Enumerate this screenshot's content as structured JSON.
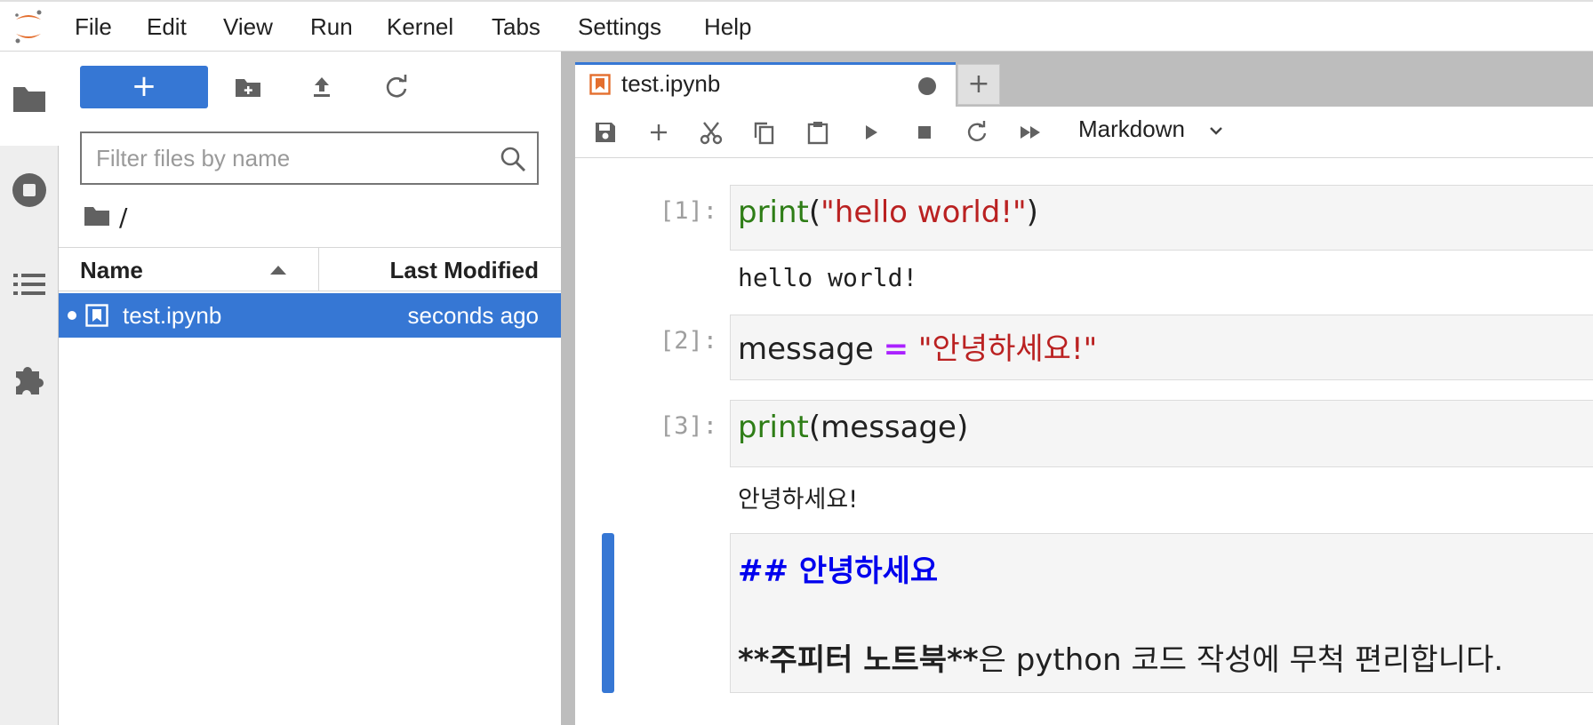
{
  "menubar": {
    "items": [
      "File",
      "Edit",
      "View",
      "Run",
      "Kernel",
      "Tabs",
      "Settings",
      "Help"
    ]
  },
  "activitybar": {
    "icons": [
      "folder-icon",
      "running-icon",
      "toc-icon",
      "extension-icon"
    ]
  },
  "filebrowser": {
    "new_label": "+",
    "filter_placeholder": "Filter files by name",
    "breadcrumb": "/",
    "columns": {
      "name": "Name",
      "modified": "Last Modified"
    },
    "files": [
      {
        "name": "test.ipynb",
        "modified": "seconds ago",
        "running": true,
        "selected": true
      }
    ]
  },
  "tabs": [
    {
      "label": "test.ipynb",
      "dirty": true,
      "active": true
    }
  ],
  "tab_add_label": "+",
  "notebook_toolbar": {
    "cell_type": "Markdown"
  },
  "cells": [
    {
      "prompt": "[1]:",
      "code": {
        "builtin": "print",
        "open": "(",
        "string": "\"hello world!\"",
        "close": ")"
      },
      "output": "hello world!"
    },
    {
      "prompt": "[2]:",
      "code": {
        "var": "message ",
        "op": "=",
        "string": " \"안녕하세요!\""
      }
    },
    {
      "prompt": "[3]:",
      "code": {
        "builtin": "print",
        "open": "(",
        "var": "message",
        "close": ")"
      },
      "output": "안녕하세요!"
    },
    {
      "type": "markdown",
      "active": true,
      "heading": "## 안녕하세요",
      "paragraph_bold": "**주피터 노트북**",
      "paragraph_rest": "은 python 코드 작성에 무척 편리합니다."
    }
  ],
  "colors": {
    "accent": "#3677d4",
    "builtin": "#2e7d16",
    "string": "#ba2121",
    "operator": "#aa22ff",
    "md_heading": "#0000ee"
  }
}
